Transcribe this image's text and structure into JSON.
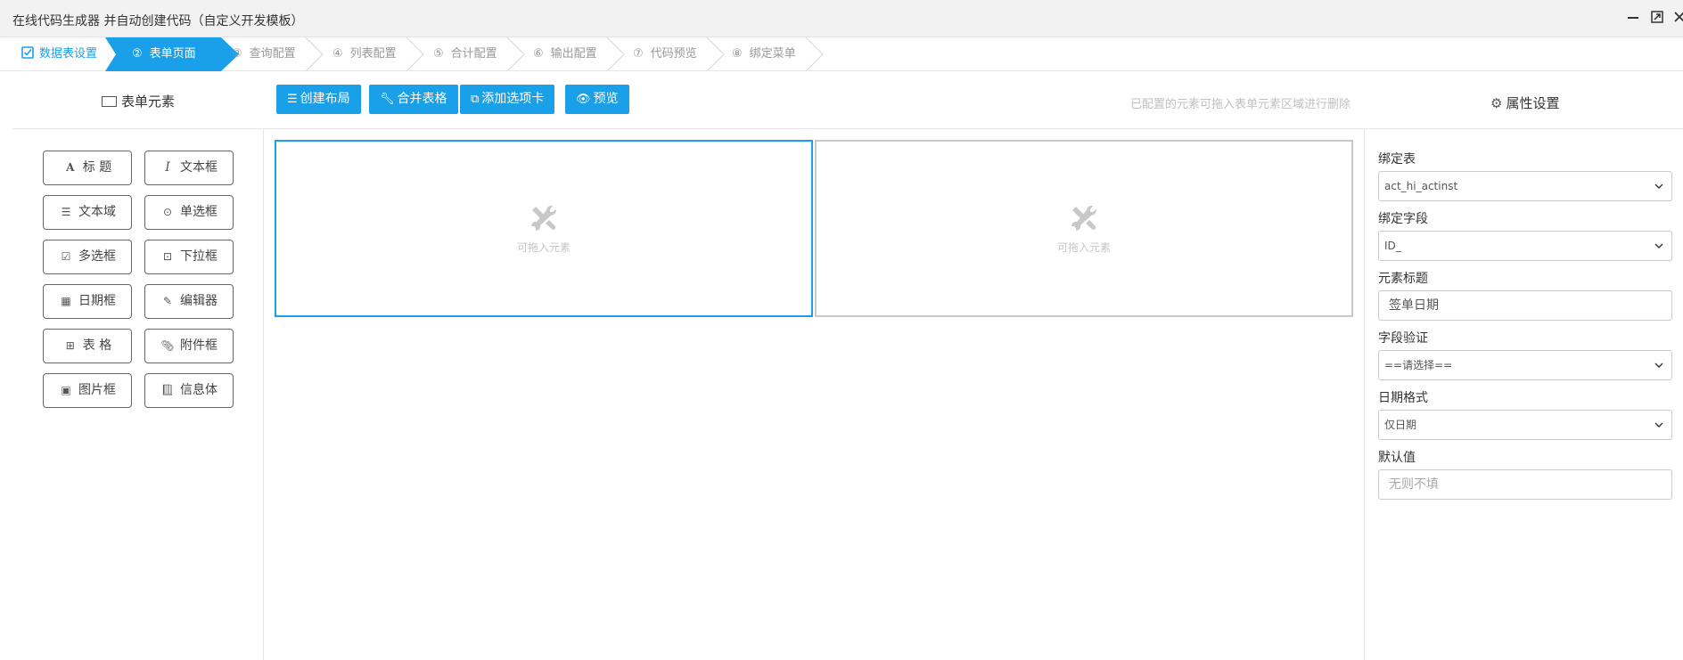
{
  "window": {
    "title": "在线代码生成器 并自动创建代码（自定义开发模板）",
    "min_icon": "minimize-icon",
    "max_icon": "maximize-icon",
    "close_icon": "close-icon"
  },
  "steps": [
    {
      "num": "☑",
      "label": "数据表设置",
      "state": "done"
    },
    {
      "num": "②",
      "label": "表单页面",
      "state": "active"
    },
    {
      "num": "③",
      "label": "查询配置",
      "state": "todo"
    },
    {
      "num": "④",
      "label": "列表配置",
      "state": "todo"
    },
    {
      "num": "⑤",
      "label": "合计配置",
      "state": "todo"
    },
    {
      "num": "⑥",
      "label": "输出配置",
      "state": "todo"
    },
    {
      "num": "⑦",
      "label": "代码预览",
      "state": "todo"
    },
    {
      "num": "⑧",
      "label": "绑定菜单",
      "state": "todo"
    }
  ],
  "left_panel": {
    "title": "表单元素",
    "elements": [
      {
        "label": "标 题",
        "icon": "font-icon"
      },
      {
        "label": "文本框",
        "icon": "italic-icon"
      },
      {
        "label": "文本域",
        "icon": "align-justify-icon"
      },
      {
        "label": "单选框",
        "icon": "radio-icon"
      },
      {
        "label": "多选框",
        "icon": "checkbox-icon"
      },
      {
        "label": "下拉框",
        "icon": "dropdown-icon"
      },
      {
        "label": "日期框",
        "icon": "calendar-icon"
      },
      {
        "label": "编辑器",
        "icon": "edit-icon"
      },
      {
        "label": "表 格",
        "icon": "table-icon"
      },
      {
        "label": "附件框",
        "icon": "paperclip-icon"
      },
      {
        "label": "图片框",
        "icon": "image-icon"
      },
      {
        "label": "信息体",
        "icon": "book-icon"
      }
    ]
  },
  "toolbar": {
    "create_layout": "创建布局",
    "merge_table": "合并表格",
    "add_tab": "添加选项卡",
    "preview": "预览",
    "hint": "已配置的元素可拖入表单元素区域进行删除"
  },
  "canvas": {
    "cells": [
      {
        "placeholder": "可拖入元素",
        "selected": true,
        "icon": "tools-icon"
      },
      {
        "placeholder": "可拖入元素",
        "selected": false,
        "icon": "tools-icon"
      }
    ]
  },
  "properties": {
    "title": "属性设置",
    "bind_table_label": "绑定表",
    "bind_table_value": "act_hi_actinst",
    "bind_field_label": "绑定字段",
    "bind_field_value": "ID_",
    "element_title_label": "元素标题",
    "element_title_value": "签单日期",
    "validation_label": "字段验证",
    "validation_value": "==请选择==",
    "date_format_label": "日期格式",
    "date_format_value": "仅日期",
    "default_label": "默认值",
    "default_placeholder": "无则不填"
  },
  "colors": {
    "accent": "#1aa0e8",
    "border": "#e6e6e6",
    "titlebar": "#f2f2f2"
  }
}
